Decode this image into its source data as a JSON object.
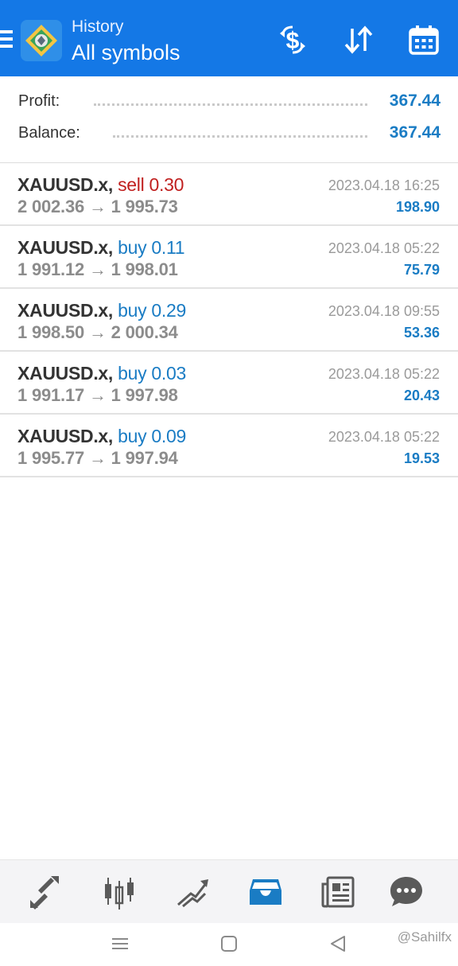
{
  "header": {
    "subtitle": "History",
    "title": "All symbols",
    "brand_color": "#1478e6"
  },
  "summary": {
    "profit_label": "Profit:",
    "profit_value": "367.44",
    "balance_label": "Balance:",
    "balance_value": "367.44"
  },
  "trades": [
    {
      "symbol": "XAUUSD.x,",
      "direction": "sell 0.30",
      "prices": "2 002.36 → 1 995.73",
      "time": "2023.04.18 16:25",
      "profit": "198.90"
    },
    {
      "symbol": "XAUUSD.x,",
      "direction": "buy 0.11",
      "prices": "1 991.12 → 1 998.01",
      "time": "2023.04.18 05:22",
      "profit": "75.79"
    },
    {
      "symbol": "XAUUSD.x,",
      "direction": "buy 0.29",
      "prices": "1 998.50 → 2 000.34",
      "time": "2023.04.18 09:55",
      "profit": "53.36"
    },
    {
      "symbol": "XAUUSD.x,",
      "direction": "buy 0.03",
      "prices": "1 991.17 → 1 997.98",
      "time": "2023.04.18 05:22",
      "profit": "20.43"
    },
    {
      "symbol": "XAUUSD.x,",
      "direction": "buy 0.09",
      "prices": "1 995.77 → 1 997.94",
      "time": "2023.04.18 05:22",
      "profit": "19.53"
    }
  ],
  "bottom_nav": {
    "items": [
      "quotes-icon",
      "chart-icon",
      "trade-icon",
      "history-icon",
      "news-icon",
      "chat-icon"
    ],
    "active": "history-icon",
    "active_color": "#1a7cc4"
  },
  "watermark": "@Sahilfx",
  "colors": {
    "sell": "#c0201f",
    "buy": "#1a7cc4",
    "profit": "#1a7cc4"
  }
}
